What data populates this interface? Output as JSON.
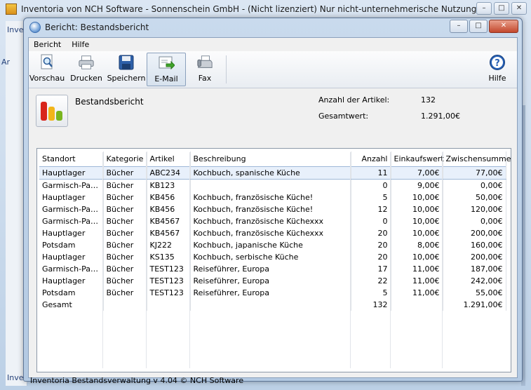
{
  "main_window": {
    "title": "Inventoria von NCH Software - Sonnenschein GmbH - (Nicht lizenziert) Nur nicht-unternehmerische Nutzung",
    "left_fragments": [
      "Inve",
      "Ar",
      "Inve"
    ]
  },
  "dialog": {
    "title": "Bericht: Bestandsbericht"
  },
  "menu": {
    "items": [
      "Bericht",
      "Hilfe"
    ]
  },
  "toolbar": {
    "preview": "Vorschau",
    "print": "Drucken",
    "save": "Speichern",
    "email": "E-Mail",
    "fax": "Fax",
    "help": "Hilfe"
  },
  "summary": {
    "title": "Bestandsbericht",
    "count_label": "Anzahl der Artikel:",
    "count_value": "132",
    "total_label": "Gesamtwert:",
    "total_value": "1.291,00€"
  },
  "table": {
    "columns": [
      "Standort",
      "Kategorie",
      "Artikel",
      "Beschreibung",
      "Anzahl",
      "Einkaufswert",
      "Zwischensumme"
    ],
    "rows": [
      [
        "Hauptlager",
        "Bücher",
        "ABC234",
        "Kochbuch, spanische Küche",
        "11",
        "7,00€",
        "77,00€"
      ],
      [
        "Garmisch-Parte...",
        "Bücher",
        "KB123",
        "",
        "0",
        "9,00€",
        "0,00€"
      ],
      [
        "Hauptlager",
        "Bücher",
        "KB456",
        "Kochbuch, französische Küche!",
        "5",
        "10,00€",
        "50,00€"
      ],
      [
        "Garmisch-Parte...",
        "Bücher",
        "KB456",
        "Kochbuch, französische Küche!",
        "12",
        "10,00€",
        "120,00€"
      ],
      [
        "Garmisch-Parte...",
        "Bücher",
        "KB4567",
        "Kochbuch, französische Küchexxx",
        "0",
        "10,00€",
        "0,00€"
      ],
      [
        "Hauptlager",
        "Bücher",
        "KB4567",
        "Kochbuch, französische Küchexxx",
        "20",
        "10,00€",
        "200,00€"
      ],
      [
        "Potsdam",
        "Bücher",
        "KJ222",
        "Kochbuch, japanische Küche",
        "20",
        "8,00€",
        "160,00€"
      ],
      [
        "Hauptlager",
        "Bücher",
        "KS135",
        "Kochbuch, serbische Küche",
        "20",
        "10,00€",
        "200,00€"
      ],
      [
        "Garmisch-Parte...",
        "Bücher",
        "TEST123",
        "Reiseführer, Europa",
        "17",
        "11,00€",
        "187,00€"
      ],
      [
        "Hauptlager",
        "Bücher",
        "TEST123",
        "Reiseführer, Europa",
        "22",
        "11,00€",
        "242,00€"
      ],
      [
        "Potsdam",
        "Bücher",
        "TEST123",
        "Reiseführer, Europa",
        "5",
        "11,00€",
        "55,00€"
      ],
      [
        "Gesamt",
        "",
        "",
        "",
        "132",
        "",
        "1.291,00€"
      ]
    ],
    "selected_row": 0
  },
  "status": {
    "text": "Inventoria Bestandsverwaltung v 4.04 © NCH Software"
  },
  "colors": {
    "chart_bars": [
      "#d8251b",
      "#f2b51a",
      "#79b51f"
    ]
  }
}
